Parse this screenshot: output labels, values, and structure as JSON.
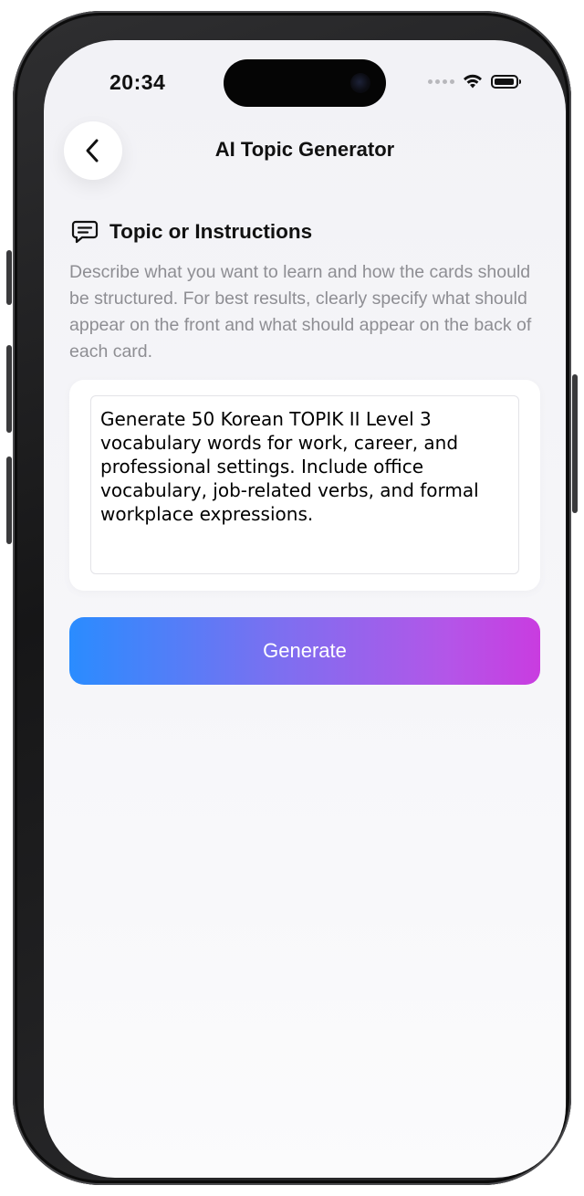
{
  "status_bar": {
    "time": "20:34"
  },
  "nav": {
    "title": "AI Topic Generator",
    "back_icon": "chevron-left-icon"
  },
  "section": {
    "icon": "message-lines-icon",
    "title": "Topic or Instructions",
    "description": "Describe what you want to learn and how the cards should be structured. For best results, clearly specify what should appear on the front and what should appear on the back of each card."
  },
  "prompt_input": {
    "value": "Generate 50 Korean TOPIK II Level 3 vocabulary words for work, career, and professional settings. Include office vocabulary, job-related verbs, and formal workplace expressions."
  },
  "generate_button": {
    "label": "Generate"
  },
  "colors": {
    "gradient_start": "#2a8cff",
    "gradient_end": "#c93ce0",
    "description_text": "#8e8e93",
    "background": "#f2f2f6"
  }
}
